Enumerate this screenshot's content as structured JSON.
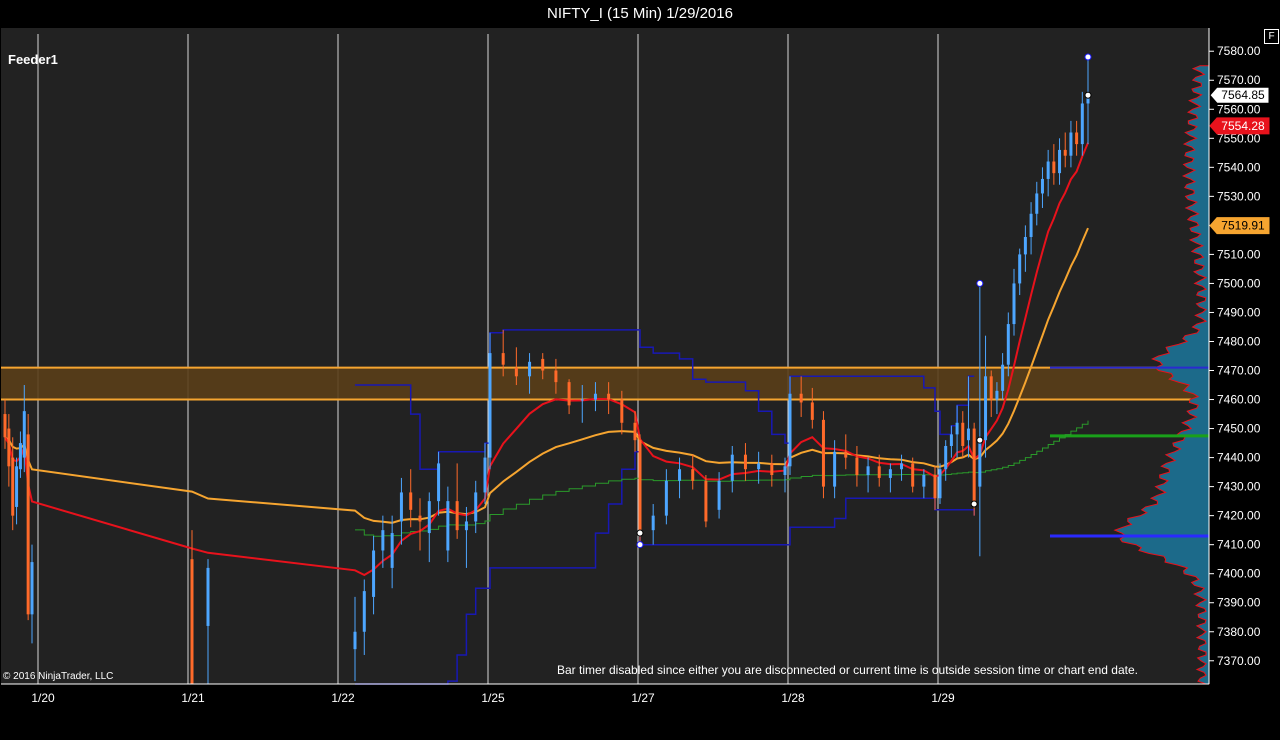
{
  "window": {
    "title": "NIFTY_I (15 Min)  1/29/2016",
    "feed_label": "Feeder1",
    "f_button": "F",
    "copyright": "© 2016 NinjaTrader, LLC",
    "bar_timer_message": "Bar timer disabled since either you are disconnected or current time is outside session time or chart end date."
  },
  "colors": {
    "background": "#000000",
    "plot_area": "#222222",
    "candle_up": "#4da6ff",
    "candle_down": "#ff6a2a",
    "ema_fast": "#e8121c",
    "ema_slow": "#f6a530",
    "vwap_step": "#2a9a2a",
    "channel": "#1818b4",
    "zone_fill": "#5a3e18",
    "zone_border": "#f6a530",
    "volume_profile_fill": "#1c6a8a",
    "volume_profile_edge": "#e8121c",
    "last_price_marker": "#ffffff",
    "red_marker": "#e8121c",
    "orange_marker": "#f6a530"
  },
  "chart_data": {
    "type": "candlestick",
    "instrument": "NIFTY_I",
    "interval": "15 Min",
    "date": "1/29/2016",
    "ylim": [
      7362,
      7588
    ],
    "y_ticks": [
      7580,
      7570,
      7560,
      7550,
      7540,
      7530,
      7520,
      7510,
      7500,
      7490,
      7480,
      7470,
      7460,
      7450,
      7440,
      7430,
      7420,
      7410,
      7400,
      7390,
      7380,
      7370
    ],
    "y_tick_labels": [
      "7580.00",
      "7570.00",
      "7560.00",
      "7550.00",
      "7540.00",
      "7530.00",
      "7520.00",
      "7510.00",
      "7500.00",
      "7490.00",
      "7480.00",
      "7470.00",
      "7460.00",
      "7450.00",
      "7440.00",
      "7430.00",
      "7420.00",
      "7410.00",
      "7400.00",
      "7390.00",
      "7380.00",
      "7370.00"
    ],
    "x_dates": [
      "1/20",
      "1/21",
      "1/22",
      "1/25",
      "1/27",
      "1/28",
      "1/29"
    ],
    "price_markers": [
      {
        "label": "7564.85",
        "value": 7564.85,
        "style": "last"
      },
      {
        "label": "7554.28",
        "value": 7554.28,
        "style": "red"
      },
      {
        "label": "7519.91",
        "value": 7519.91,
        "style": "orange"
      }
    ],
    "zone": {
      "high": 7471,
      "low": 7460
    },
    "volume_profile_levels": {
      "poc": 7413,
      "value_area_high": 7471,
      "green_level": 7447.5
    },
    "candles": [
      [
        7455,
        7460,
        7443,
        7447
      ],
      [
        7450,
        7455,
        7430,
        7437
      ],
      [
        7440,
        7447,
        7415,
        7420
      ],
      [
        7423,
        7440,
        7417,
        7437
      ],
      [
        7436,
        7449,
        7433,
        7445
      ],
      [
        7440,
        7465,
        7435,
        7456
      ],
      [
        7448,
        7455,
        7384,
        7386
      ],
      [
        7386,
        7410,
        7376,
        7404
      ],
      [
        7405,
        7415,
        7350,
        7352
      ],
      [
        7382,
        7405,
        7362,
        7402
      ],
      [
        7374,
        7392,
        7363,
        7380
      ],
      [
        7380,
        7398,
        7372,
        7394
      ],
      [
        7392,
        7413,
        7386,
        7408
      ],
      [
        7408,
        7420,
        7402,
        7415
      ],
      [
        7402,
        7420,
        7395,
        7414
      ],
      [
        7418,
        7433,
        7410,
        7428
      ],
      [
        7428,
        7436,
        7416,
        7422
      ],
      [
        7420,
        7426,
        7408,
        7418
      ],
      [
        7414,
        7428,
        7404,
        7425
      ],
      [
        7425,
        7442,
        7420,
        7438
      ],
      [
        7408,
        7430,
        7404,
        7425
      ],
      [
        7425,
        7438,
        7412,
        7415
      ],
      [
        7415,
        7423,
        7402,
        7418
      ],
      [
        7418,
        7432,
        7414,
        7428
      ],
      [
        7428,
        7445,
        7424,
        7440
      ],
      [
        7440,
        7483,
        7436,
        7476
      ],
      [
        7476,
        7484,
        7468,
        7472
      ],
      [
        7471,
        7478,
        7465,
        7468
      ],
      [
        7468,
        7476,
        7462,
        7473
      ],
      [
        7474,
        7476,
        7467,
        7470
      ],
      [
        7470,
        7474,
        7462,
        7466
      ],
      [
        7466,
        7467,
        7455,
        7458
      ],
      [
        7460,
        7465,
        7452,
        7460
      ],
      [
        7460,
        7466,
        7456,
        7462
      ],
      [
        7462,
        7466,
        7455,
        7460
      ],
      [
        7460,
        7463,
        7448,
        7452
      ],
      [
        7452,
        7456,
        7442,
        7446
      ],
      [
        7446,
        7448,
        7410,
        7414
      ],
      [
        7415,
        7424,
        7410,
        7420
      ],
      [
        7420,
        7436,
        7417,
        7432
      ],
      [
        7432,
        7440,
        7426,
        7436
      ],
      [
        7436,
        7441,
        7429,
        7432
      ],
      [
        7432,
        7434,
        7416,
        7418
      ],
      [
        7422,
        7435,
        7419,
        7432
      ],
      [
        7432,
        7444,
        7428,
        7441
      ],
      [
        7441,
        7445,
        7432,
        7436
      ],
      [
        7436,
        7442,
        7431,
        7438
      ],
      [
        7438,
        7441,
        7430,
        7434
      ],
      [
        7434,
        7440,
        7428,
        7437
      ],
      [
        7437,
        7468,
        7434,
        7462
      ],
      [
        7462,
        7468,
        7454,
        7459
      ],
      [
        7459,
        7464,
        7450,
        7453
      ],
      [
        7453,
        7456,
        7426,
        7430
      ],
      [
        7430,
        7446,
        7426,
        7442
      ],
      [
        7442,
        7448,
        7436,
        7440
      ],
      [
        7440,
        7444,
        7430,
        7434
      ],
      [
        7434,
        7440,
        7428,
        7437
      ],
      [
        7437,
        7441,
        7430,
        7433
      ],
      [
        7433,
        7438,
        7428,
        7436
      ],
      [
        7436,
        7441,
        7432,
        7438
      ],
      [
        7438,
        7440,
        7428,
        7430
      ],
      [
        7430,
        7436,
        7426,
        7434
      ],
      [
        7434,
        7437,
        7422,
        7426
      ],
      [
        7426,
        7438,
        7424,
        7436
      ],
      [
        7436,
        7446,
        7432,
        7444
      ],
      [
        7444,
        7451,
        7440,
        7448
      ],
      [
        7448,
        7458,
        7440,
        7452
      ],
      [
        7452,
        7456,
        7440,
        7444
      ],
      [
        7446,
        7468,
        7440,
        7450
      ],
      [
        7450,
        7452,
        7420,
        7424
      ],
      [
        7430,
        7500,
        7406,
        7446
      ],
      [
        7446,
        7482,
        7440,
        7468
      ],
      [
        7468,
        7470,
        7454,
        7460
      ],
      [
        7460,
        7466,
        7455,
        7463
      ],
      [
        7463,
        7476,
        7460,
        7472
      ],
      [
        7472,
        7490,
        7468,
        7486
      ],
      [
        7486,
        7505,
        7482,
        7500
      ],
      [
        7500,
        7512,
        7496,
        7510
      ],
      [
        7510,
        7520,
        7504,
        7516
      ],
      [
        7516,
        7528,
        7510,
        7524
      ],
      [
        7524,
        7535,
        7520,
        7531
      ],
      [
        7531,
        7540,
        7526,
        7536
      ],
      [
        7536,
        7546,
        7530,
        7542
      ],
      [
        7542,
        7548,
        7534,
        7538
      ],
      [
        7538,
        7550,
        7534,
        7546
      ],
      [
        7546,
        7552,
        7540,
        7544
      ],
      [
        7544,
        7556,
        7540,
        7552
      ],
      [
        7552,
        7556,
        7544,
        7548
      ],
      [
        7548,
        7566,
        7544,
        7562
      ],
      [
        7562,
        7578,
        7548,
        7564.85
      ]
    ]
  }
}
